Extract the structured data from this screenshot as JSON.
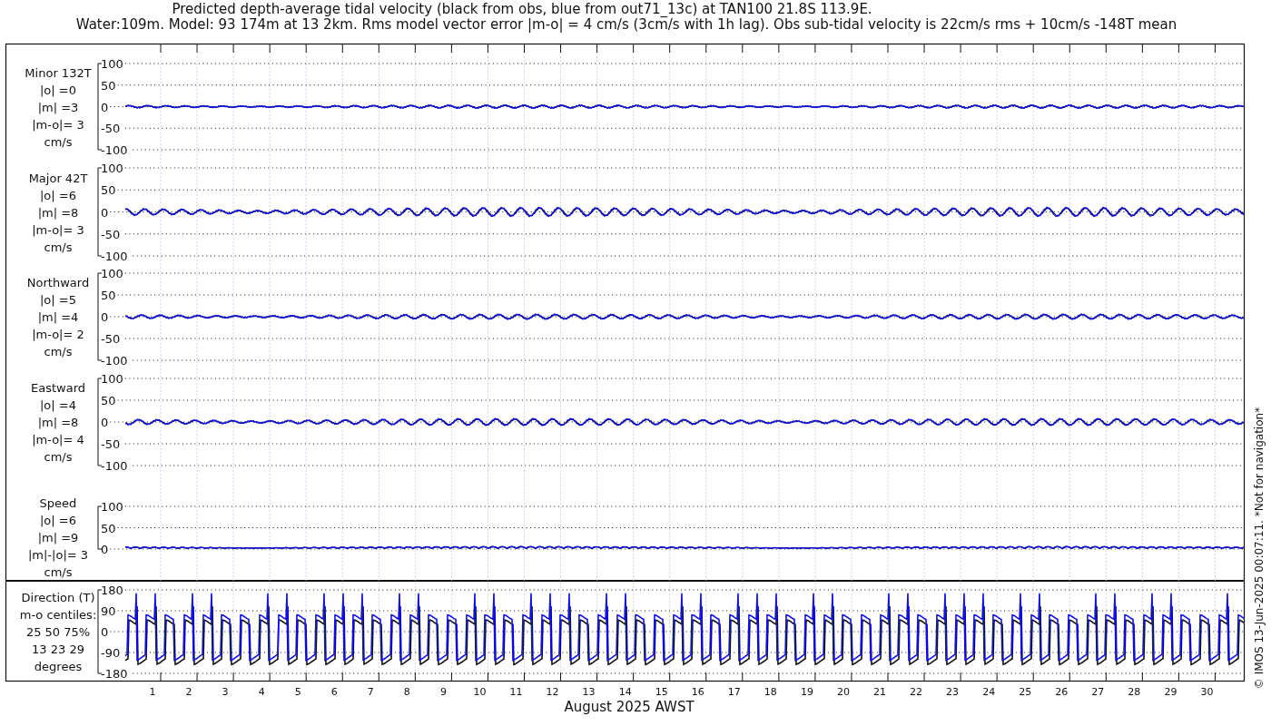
{
  "title_lines": [
    "Predicted depth-average tidal velocity (black from obs, blue from out71_13c) at TAN100 21.8S 113.9E.",
    "Water:109m. Model: 93 174m at 13 2km. Rms model vector error |m-o| = 4 cm/s (3cm/s with 1h lag). Obs sub-tidal velocity is 22cm/s rms + 10cm/s -148T mean"
  ],
  "panels": [
    {
      "kind": "velocity",
      "label_lines": [
        "Minor 132T",
        "|o| =0",
        "|m| =3",
        "|m-o|= 3",
        "cm/s"
      ],
      "tick_labels": [
        "100",
        "50",
        "0",
        "-50",
        "-100"
      ]
    },
    {
      "kind": "velocity",
      "label_lines": [
        "Major 42T",
        "|o| =6",
        "|m| =8",
        "|m-o|= 3",
        "cm/s"
      ],
      "tick_labels": [
        "100",
        "50",
        "0",
        "-50",
        "-100"
      ]
    },
    {
      "kind": "velocity",
      "label_lines": [
        "Northward",
        "|o| =5",
        "|m| =4",
        "|m-o|= 2",
        "cm/s"
      ],
      "tick_labels": [
        "100",
        "50",
        "0",
        "-50",
        "-100"
      ]
    },
    {
      "kind": "velocity",
      "label_lines": [
        "Eastward",
        "|o| =4",
        "|m| =8",
        "|m-o|= 4",
        "cm/s"
      ],
      "tick_labels": [
        "100",
        "50",
        "0",
        "-50",
        "-100"
      ]
    },
    {
      "kind": "speed",
      "label_lines": [
        "Speed",
        "|o| =6",
        "|m| =9",
        "|m|-|o|= 3",
        "cm/s"
      ],
      "tick_labels": [
        "100",
        "50",
        "0"
      ]
    },
    {
      "kind": "direction",
      "label_lines": [
        "Direction (T)",
        "m-o centiles:",
        "25  50  75%",
        "13  23  29",
        "degrees"
      ],
      "tick_labels": [
        "180",
        "90",
        "0",
        "-90",
        "-180"
      ]
    }
  ],
  "x_tick_labels": [
    "1",
    "2",
    "3",
    "4",
    "5",
    "6",
    "7",
    "8",
    "9",
    "10",
    "11",
    "12",
    "13",
    "14",
    "15",
    "16",
    "17",
    "18",
    "19",
    "20",
    "21",
    "22",
    "23",
    "24",
    "25",
    "26",
    "27",
    "28",
    "29",
    "30"
  ],
  "xlabel": "August 2025 AWST",
  "footer": "© IMOS 13-Jun-2025 00:07:11. *Not for navigation*"
}
